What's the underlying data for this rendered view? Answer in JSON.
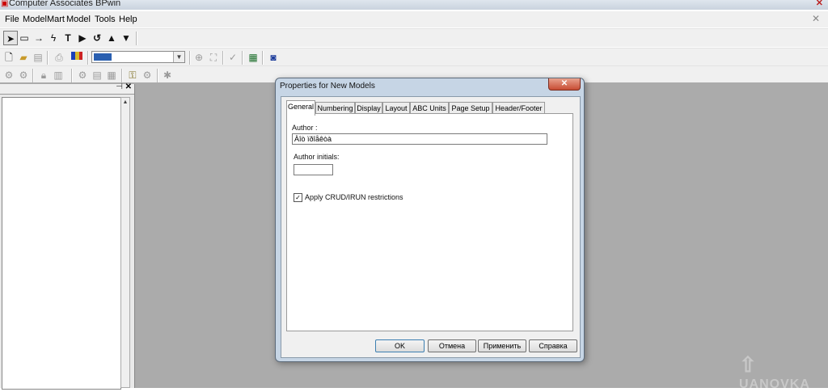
{
  "window": {
    "title": "Computer Associates BPwin"
  },
  "menu": [
    "File",
    "ModelMart",
    "Model",
    "Tools",
    "Help"
  ],
  "toolbar": {
    "combo_value": ""
  },
  "dialog": {
    "title": "Properties for New Models",
    "close": "✕",
    "tabs": [
      "General",
      "Numbering",
      "Display",
      "Layout",
      "ABC Units",
      "Page Setup",
      "Header/Footer"
    ],
    "active_tab": "General",
    "author_label": "Author :",
    "author_value": "Àîò ïðîåêòà",
    "initials_label": "Author initials:",
    "initials_value": "",
    "checkbox_label": "Apply CRUD/IRUN restrictions",
    "checkbox_checked": true,
    "buttons": {
      "ok": "OK",
      "cancel": "Отмена",
      "apply": "Применить",
      "help": "Справка"
    }
  },
  "watermark": "UANOVKA",
  "colors": {
    "workspace": "#ababab",
    "dialog_frame": "#c6d5e5",
    "close_button": "#c74c33"
  }
}
